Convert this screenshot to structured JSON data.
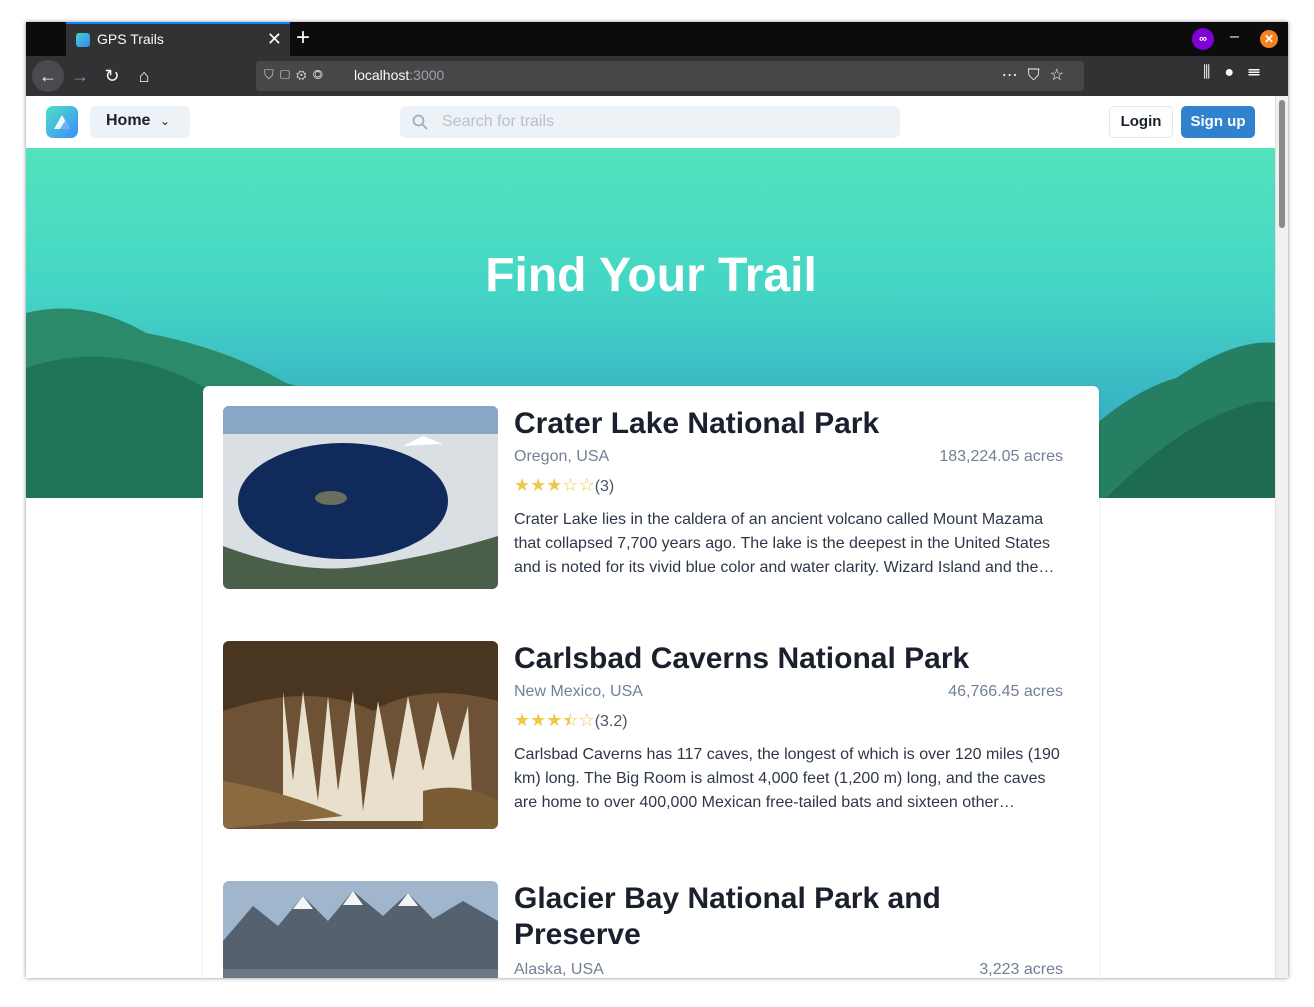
{
  "browser": {
    "tab_title": "GPS Trails",
    "url_host": "localhost",
    "url_port": ":3000"
  },
  "header": {
    "home_label": "Home",
    "search_placeholder": "Search for trails",
    "login_label": "Login",
    "signup_label": "Sign up"
  },
  "hero": {
    "title": "Find Your Trail"
  },
  "parks": [
    {
      "name": "Crater Lake National Park",
      "location": "Oregon, USA",
      "area": "183,224.05 acres",
      "rating": 3,
      "rating_text": "(3)",
      "description": "Crater Lake lies in the caldera of an ancient volcano called Mount Mazama that collapsed 7,700 years ago. The lake is the deepest in the United States and is noted for its vivid blue color and water clarity. Wizard Island and the…"
    },
    {
      "name": "Carlsbad Caverns National Park",
      "location": "New Mexico, USA",
      "area": "46,766.45 acres",
      "rating": 3.2,
      "rating_text": "(3.2)",
      "description": "Carlsbad Caverns has 117 caves, the longest of which is over 120 miles (190 km) long. The Big Room is almost 4,000 feet (1,200 m) long, and the caves are home to over 400,000 Mexican free-tailed bats and sixteen other…"
    },
    {
      "name": "Glacier Bay National Park and Preserve",
      "location": "Alaska, USA",
      "area": "3,223 acres"
    }
  ],
  "colors": {
    "accent": "#3182ce",
    "star": "#ecc94b",
    "hero_top": "#52e2bd",
    "hero_bottom": "#2b8fa8"
  },
  "icons": [
    "firefox-tab-favicon",
    "close-icon",
    "plus-icon",
    "private-mask-icon",
    "minimize-icon",
    "back-arrow-icon",
    "forward-arrow-icon",
    "reload-icon",
    "home-icon",
    "shield-icon",
    "page-icon",
    "permissions-icon",
    "more-icon",
    "pocket-icon",
    "star-bookmark-icon",
    "library-icon",
    "account-icon",
    "menu-icon",
    "search-icon",
    "chevron-down-icon",
    "logo-icon"
  ]
}
